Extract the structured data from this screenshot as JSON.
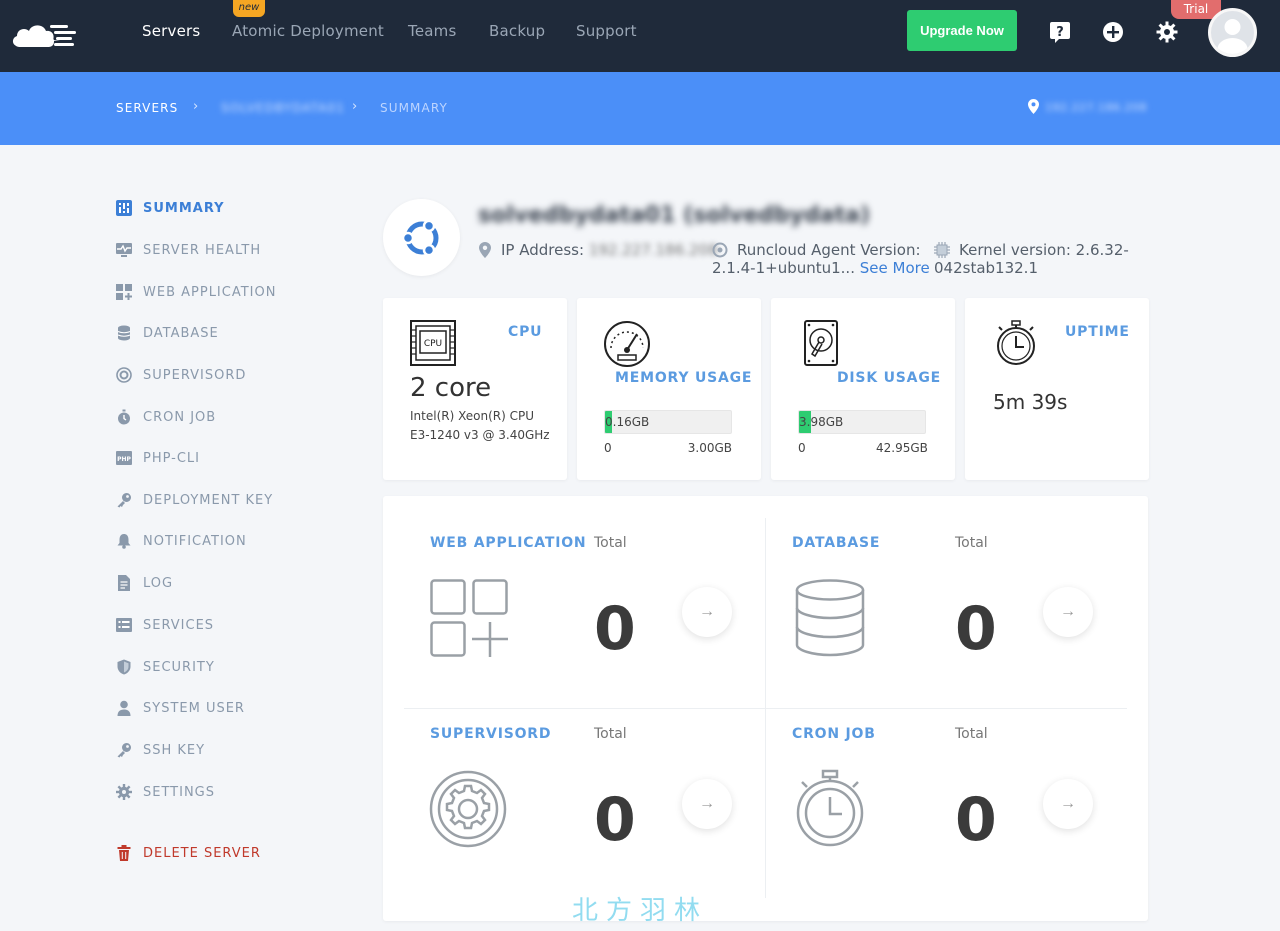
{
  "nav": {
    "items": [
      "Servers",
      "Atomic Deployment",
      "Teams",
      "Backup",
      "Support"
    ],
    "new_badge": "new",
    "upgrade_label": "Upgrade Now",
    "trial_badge": "Trial"
  },
  "breadcrumb": {
    "root": "SERVERS",
    "server": "SOLVEDBYDATA01",
    "current": "SUMMARY",
    "ip": "192.227.186.208"
  },
  "sidebar": {
    "items": [
      "SUMMARY",
      "SERVER HEALTH",
      "WEB APPLICATION",
      "DATABASE",
      "SUPERVISORD",
      "CRON JOB",
      "PHP-CLI",
      "DEPLOYMENT KEY",
      "NOTIFICATION",
      "LOG",
      "SERVICES",
      "SECURITY",
      "SYSTEM USER",
      "SSH KEY",
      "SETTINGS"
    ],
    "delete_label": "DELETE SERVER",
    "php_icon_text": "PHP"
  },
  "server": {
    "name": "solvedbydata01 (solvedbydata)",
    "ip_label": "IP Address:",
    "ip_value": "192.227.186.208",
    "agent_line1": "Runcloud Agent Version:",
    "agent_line2": "2.1.4-1+ubuntu1...",
    "see_more": "See More",
    "kernel_line1": "Kernel version: 2.6.32-",
    "kernel_line2": "042stab132.1"
  },
  "stats": {
    "cpu": {
      "title": "CPU",
      "icon_text": "CPU",
      "cores": "2 core",
      "model_line1": "Intel(R) Xeon(R) CPU",
      "model_line2": "E3-1240 v3 @ 3.40GHz"
    },
    "memory": {
      "title": "MEMORY USAGE",
      "used": "0.16GB",
      "min": "0",
      "max": "3.00GB",
      "fraction": 0.053
    },
    "disk": {
      "title": "DISK USAGE",
      "used": "3.98GB",
      "min": "0",
      "max": "42.95GB",
      "fraction": 0.093
    },
    "uptime": {
      "title": "UPTIME",
      "value": "5m 39s"
    }
  },
  "totals": {
    "label": "Total",
    "web_app": {
      "title": "WEB APPLICATION",
      "count": "0"
    },
    "database": {
      "title": "DATABASE",
      "count": "0"
    },
    "supervisord": {
      "title": "SUPERVISORD",
      "count": "0"
    },
    "cron": {
      "title": "CRON JOB",
      "count": "0"
    },
    "arrow": "→"
  },
  "watermark": "北方羽林"
}
